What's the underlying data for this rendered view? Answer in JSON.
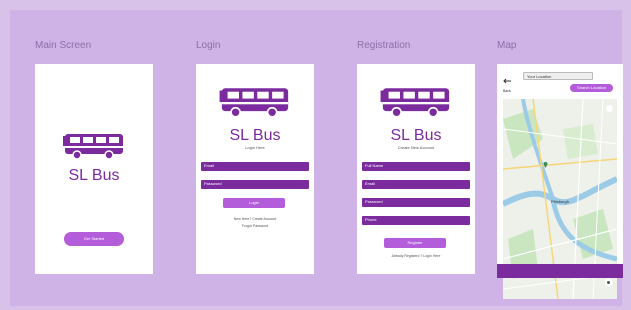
{
  "frames": {
    "main": {
      "title": "Main Screen",
      "brand": "SL Bus",
      "button": "Get Started"
    },
    "login": {
      "title": "Login",
      "brand": "SL Bus",
      "subtitle": "Login Here",
      "email_placeholder": "Email",
      "password_placeholder": "Password",
      "button": "Login",
      "signup_text": "New Here? Create Account",
      "forgot_text": "Forgot Password"
    },
    "registration": {
      "title": "Registration",
      "brand": "SL Bus",
      "subtitle": "Create New Account",
      "fields": [
        "Full Name",
        "Email",
        "Password",
        "Phone"
      ],
      "button": "Register",
      "login_text": "Already Registerd ? Login Here"
    },
    "map": {
      "title": "Map",
      "back_label": "Back",
      "search_value": "Your Location",
      "button": "Search Location",
      "place_label": "Pittsburgh"
    }
  },
  "colors": {
    "background": "#cfb3e6",
    "primary": "#7b2b9e",
    "accent": "#b35ddb"
  },
  "icons": [
    "bus-icon",
    "back-arrow-icon",
    "location-pin-icon",
    "locate-me-icon"
  ]
}
